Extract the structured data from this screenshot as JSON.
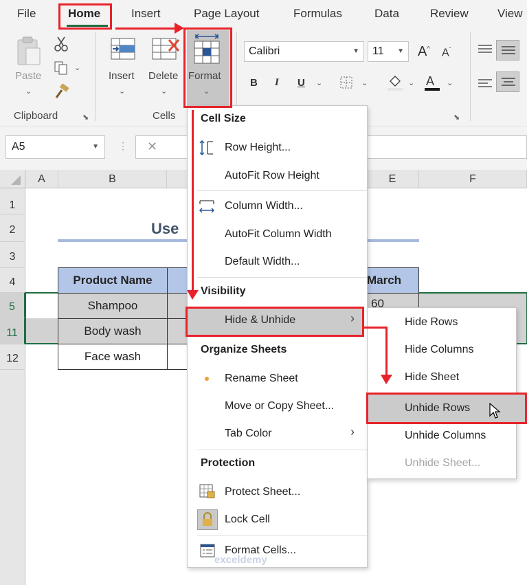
{
  "menubar": {
    "tabs": [
      "File",
      "Home",
      "Insert",
      "Page Layout",
      "Formulas",
      "Data",
      "Review",
      "View"
    ]
  },
  "ribbon": {
    "clipboard": {
      "paste": "Paste",
      "group": "Clipboard"
    },
    "cells": {
      "insert": "Insert",
      "delete": "Delete",
      "format": "Format",
      "group": "Cells"
    },
    "font": {
      "name": "Calibri",
      "size": "11",
      "bold": "B",
      "italic": "I",
      "underline": "U"
    }
  },
  "formula_bar": {
    "name_box": "A5"
  },
  "grid": {
    "columns": [
      "A",
      "B",
      "E",
      "F"
    ],
    "rows": [
      "1",
      "2",
      "3",
      "4",
      "5",
      "11",
      "12"
    ],
    "title_fragment": "Use",
    "header_product": "Product Name",
    "header_march": "March",
    "products": [
      "Shampoo",
      "Body wash",
      "Face wash"
    ],
    "value_fragment": "60"
  },
  "format_menu": {
    "cell_size": "Cell Size",
    "row_height": "Row Height...",
    "autofit_row": "AutoFit Row Height",
    "column_width": "Column Width...",
    "autofit_col": "AutoFit Column Width",
    "default_width": "Default Width...",
    "visibility": "Visibility",
    "hide_unhide": "Hide & Unhide",
    "organize": "Organize Sheets",
    "rename": "Rename Sheet",
    "move_copy": "Move or Copy Sheet...",
    "tab_color": "Tab Color",
    "protection": "Protection",
    "protect_sheet": "Protect Sheet...",
    "lock_cell": "Lock Cell",
    "format_cells": "Format Cells..."
  },
  "hide_menu": {
    "hide_rows": "Hide Rows",
    "hide_columns": "Hide Columns",
    "hide_sheet": "Hide Sheet",
    "unhide_rows": "Unhide Rows",
    "unhide_columns": "Unhide Columns",
    "unhide_sheet": "Unhide Sheet..."
  },
  "watermark": "exceldemy",
  "colors": {
    "accent_green": "#1e6e42",
    "annotation_red": "#e8222a",
    "header_blue": "#b4c6e7"
  }
}
